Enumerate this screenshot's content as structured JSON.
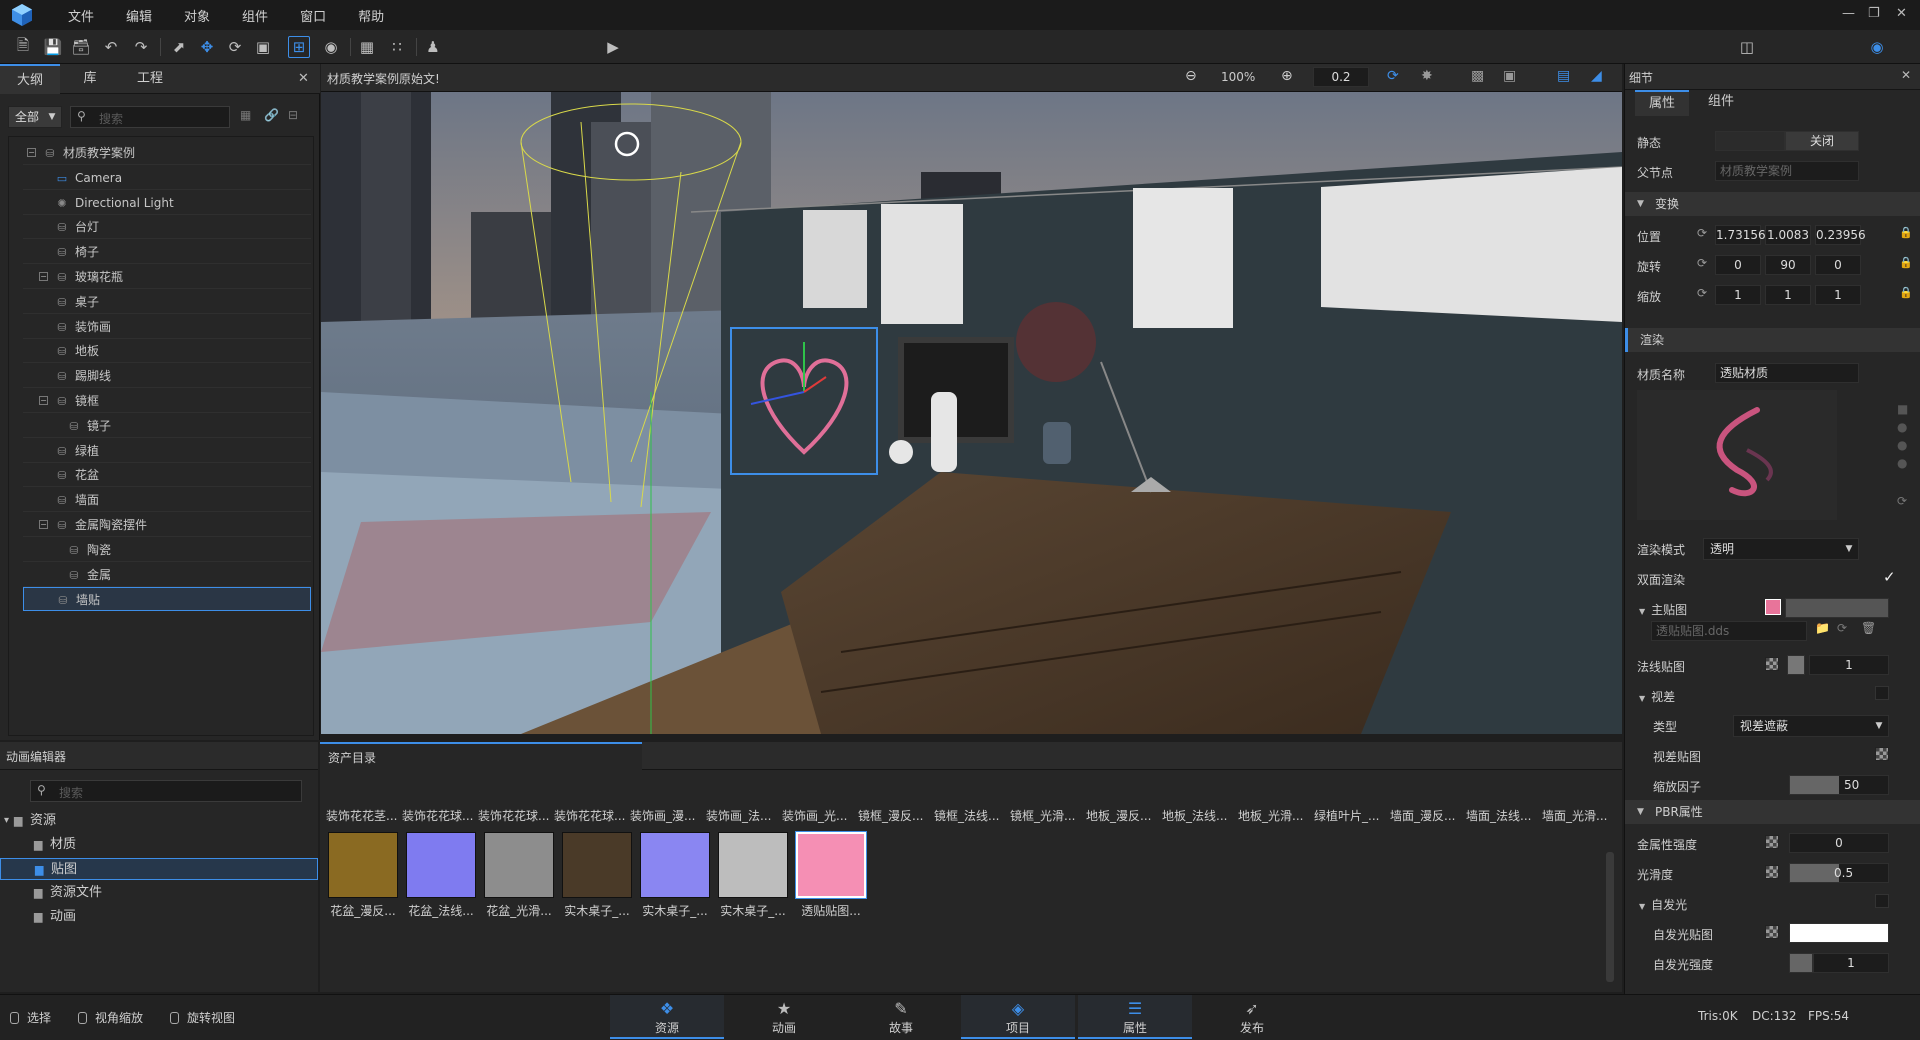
{
  "menubar": {
    "items": [
      "文件",
      "编辑",
      "对象",
      "组件",
      "窗口",
      "帮助"
    ]
  },
  "toolbar": {
    "preview_mode": "预览",
    "layout_mode": "经典"
  },
  "outline": {
    "tabs": [
      "大纲",
      "库",
      "工程"
    ],
    "filter": "全部",
    "search_placeholder": "搜索",
    "tree": [
      {
        "label": "材质教学案例",
        "depth": 0,
        "icon": "scene-node-icon",
        "expandable": true
      },
      {
        "label": "Camera",
        "depth": 1,
        "icon": "camera-icon"
      },
      {
        "label": "Directional Light",
        "depth": 1,
        "icon": "light-icon"
      },
      {
        "label": "台灯",
        "depth": 1,
        "icon": "node-icon"
      },
      {
        "label": "椅子",
        "depth": 1,
        "icon": "node-icon"
      },
      {
        "label": "玻璃花瓶",
        "depth": 1,
        "icon": "node-icon",
        "expandable": true
      },
      {
        "label": "桌子",
        "depth": 1,
        "icon": "node-icon"
      },
      {
        "label": "装饰画",
        "depth": 1,
        "icon": "node-icon"
      },
      {
        "label": "地板",
        "depth": 1,
        "icon": "node-icon"
      },
      {
        "label": "踢脚线",
        "depth": 1,
        "icon": "node-icon"
      },
      {
        "label": "镜框",
        "depth": 1,
        "icon": "node-icon",
        "expandable": true
      },
      {
        "label": "镜子",
        "depth": 2,
        "icon": "node-icon"
      },
      {
        "label": "绿植",
        "depth": 1,
        "icon": "node-icon"
      },
      {
        "label": "花盆",
        "depth": 1,
        "icon": "node-icon"
      },
      {
        "label": "墙面",
        "depth": 1,
        "icon": "node-icon"
      },
      {
        "label": "金属陶瓷摆件",
        "depth": 1,
        "icon": "node-icon",
        "expandable": true
      },
      {
        "label": "陶瓷",
        "depth": 2,
        "icon": "node-icon"
      },
      {
        "label": "金属",
        "depth": 2,
        "icon": "node-icon"
      },
      {
        "label": "墙贴",
        "depth": 1,
        "icon": "node-icon",
        "selected": true
      }
    ]
  },
  "viewport": {
    "title": "材质教学案例原始文!",
    "zoom": "100%",
    "step": "0.2"
  },
  "details": {
    "title": "细节",
    "tabs": [
      "属性",
      "组件"
    ],
    "static_label": "静态",
    "static_value": "关闭",
    "parent_label": "父节点",
    "parent_value": "材质教学案例",
    "transform_section": "变换",
    "position_label": "位置",
    "position": [
      "1.73156",
      "1.0083",
      "0.23956"
    ],
    "rotation_label": "旋转",
    "rotation": [
      "0",
      "90",
      "0"
    ],
    "scale_label": "缩放",
    "scale": [
      "1",
      "1",
      "1"
    ],
    "render_section": "渲染",
    "material_name_label": "材质名称",
    "material_name": "透贴材质",
    "render_mode_label": "渲染模式",
    "render_mode": "透明",
    "double_sided_label": "双面渲染",
    "main_texture_label": "主贴图",
    "main_texture_file": "透贴贴图.dds",
    "main_color": "#e8749a",
    "normal_map_label": "法线贴图",
    "normal_value": "1",
    "parallax_label": "视差",
    "type_label": "类型",
    "type_value": "视差遮蔽",
    "parallax_map_label": "视差贴图",
    "scale_factor_label": "缩放因子",
    "scale_factor": "50",
    "scale_factor_fill": 0.5,
    "pbr_section": "PBR属性",
    "metallic_label": "金属性强度",
    "metallic_value": "0",
    "smoothness_label": "光滑度",
    "smoothness_value": "0.5",
    "smoothness_fill": 0.5,
    "emission_label": "自发光",
    "emission_map_label": "自发光贴图",
    "emission_intensity_label": "自发光强度",
    "emission_intensity": "1"
  },
  "anim_editor": {
    "title": "动画编辑器",
    "search_placeholder": "搜索",
    "tree": [
      {
        "label": "资源",
        "depth": 0,
        "expanded": true
      },
      {
        "label": "材质",
        "depth": 1
      },
      {
        "label": "贴图",
        "depth": 1,
        "selected": true
      },
      {
        "label": "资源文件",
        "depth": 1
      },
      {
        "label": "动画",
        "depth": 1
      }
    ]
  },
  "assets": {
    "title": "资产目录",
    "header_row": [
      "装饰花花茎...",
      "装饰花花球...",
      "装饰花花球...",
      "装饰花花球...",
      "装饰画_漫...",
      "装饰画_法...",
      "装饰画_光...",
      "镜框_漫反...",
      "镜框_法线...",
      "镜框_光滑...",
      "地板_漫反...",
      "地板_法线...",
      "地板_光滑...",
      "绿植叶片_...",
      "墙面_漫反...",
      "墙面_法线...",
      "墙面_光滑..."
    ],
    "items": [
      {
        "label": "花盆_漫反...",
        "swatch": "#8a6a22"
      },
      {
        "label": "花盆_法线...",
        "swatch": "#7f7bf0"
      },
      {
        "label": "花盆_光滑...",
        "swatch": "#8d8d8d"
      },
      {
        "label": "实木桌子_...",
        "swatch": "#4a3a28"
      },
      {
        "label": "实木桌子_...",
        "swatch": "#8a86f2"
      },
      {
        "label": "实木桌子_...",
        "swatch": "#bdbdbd"
      },
      {
        "label": "透贴贴图...",
        "swatch": "#f58fb4",
        "selected": true
      }
    ]
  },
  "statusbar": {
    "modes": [
      "选择",
      "视角缩放",
      "旋转视图"
    ],
    "tabs": [
      {
        "label": "资源",
        "icon": "resource-icon",
        "active": true
      },
      {
        "label": "动画",
        "icon": "animation-icon"
      },
      {
        "label": "故事",
        "icon": "story-icon"
      },
      {
        "label": "项目",
        "icon": "project-icon",
        "active": true
      },
      {
        "label": "属性",
        "icon": "properties-icon",
        "active": true
      },
      {
        "label": "发布",
        "icon": "publish-icon"
      }
    ],
    "tris": "Tris:0K",
    "dc": "DC:132",
    "fps": "FPS:54"
  },
  "colors": {
    "accent": "#3d8ee8",
    "panel": "#262626",
    "bg": "#1e1e1e"
  }
}
